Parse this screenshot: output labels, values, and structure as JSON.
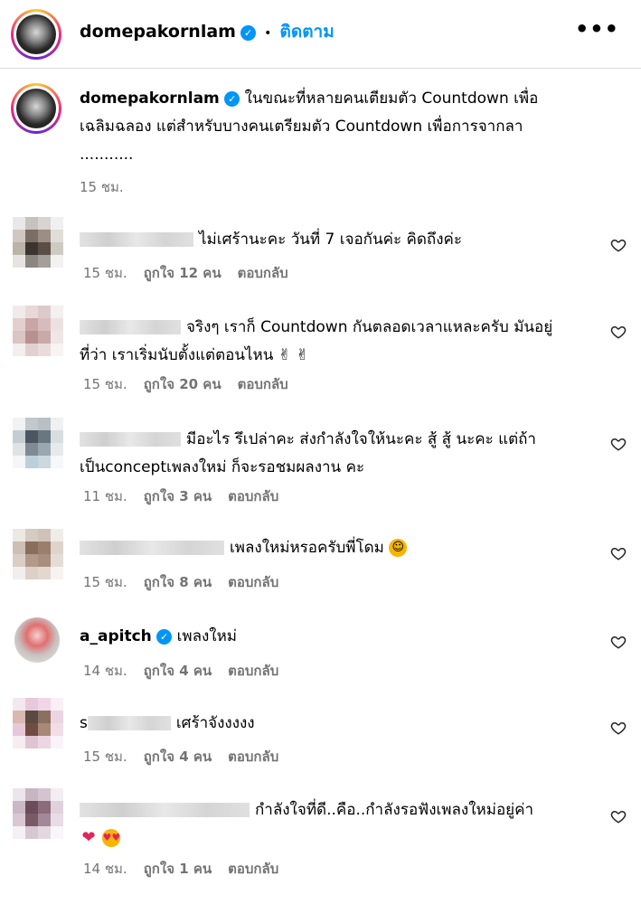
{
  "header": {
    "username": "domepakornlam",
    "separator": "•",
    "follow_label": "ติดตาม",
    "more_label": "•••"
  },
  "caption": {
    "username": "domepakornlam",
    "text_line1": "ในขณะที่หลายคนเตียมตัว Countdown เพื่อ",
    "text_line2": "เฉลิมฉลอง แต่สำหรับบางคนเตรียมตัว Countdown เพื่อการจากลา",
    "text_line3": "...........",
    "time": "15 ชม."
  },
  "comments": [
    {
      "prefix": "",
      "line1": "ไม่เศร้านะคะ วันที่ 7 เจอกันค่ะ คิดถึงค่ะ",
      "line2": "",
      "time": "15 ชม.",
      "likes": "ถูกใจ 12 คน",
      "reply": "ตอบกลับ"
    },
    {
      "prefix": "",
      "line1": "จริงๆ เราก็ Countdown กันตลอดเวลาแหละครับ มันอยู่",
      "line2": "ที่ว่า เราเริ่มนับตั้งแต่ตอนไหน ✌ ✌",
      "time": "15 ชม.",
      "likes": "ถูกใจ 20 คน",
      "reply": "ตอบกลับ"
    },
    {
      "prefix": "",
      "line1": "มีอะไร รึเปล่าคะ ส่งกำลังใจให้นะคะ สู้ สู้ นะคะ แต่ถ้า",
      "line2": "เป็นconceptเพลงใหม่ ก็จะรอชมผลงาน คะ",
      "time": "11 ชม.",
      "likes": "ถูกใจ 3 คน",
      "reply": "ตอบกลับ"
    },
    {
      "prefix": "",
      "line1": "เพลงใหม่หรอครับพี่โดม",
      "line2": "",
      "time": "15 ชม.",
      "likes": "ถูกใจ 8 คน",
      "reply": "ตอบกลับ"
    },
    {
      "prefix": "a_apitch",
      "line1": "เพลงใหม่",
      "line2": "",
      "time": "14 ชม.",
      "likes": "ถูกใจ 4 คน",
      "reply": "ตอบกลับ"
    },
    {
      "prefix": "s",
      "line1": "เศร้าจังงงงง",
      "line2": "",
      "time": "15 ชม.",
      "likes": "ถูกใจ 4 คน",
      "reply": "ตอบกลับ"
    },
    {
      "prefix": "",
      "line1": "กำลังใจที่ดี..คือ..กำลังรอฟังเพลงใหม่อยู่ค่า",
      "line2": "",
      "time": "14 ชม.",
      "likes": "ถูกใจ 1 คน",
      "reply": "ตอบกลับ"
    }
  ],
  "colors": {
    "link": "#0095f6",
    "meta": "#737373",
    "verified": "#0095f6"
  },
  "icons": [
    "verified-badge-icon",
    "more-options-icon",
    "heart-icon",
    "smile-emoji-icon",
    "red-heart-emoji-icon",
    "heart-eyes-emoji-icon",
    "victory-hand-emoji-icon"
  ]
}
